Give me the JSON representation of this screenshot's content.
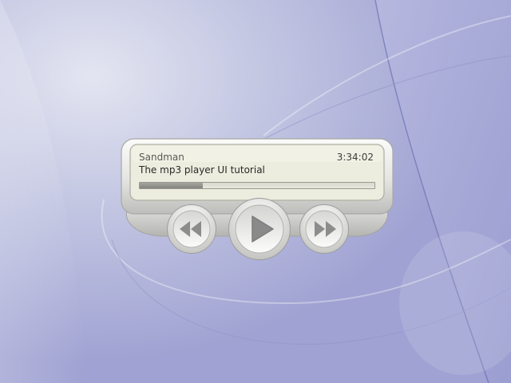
{
  "player": {
    "artist": "Sandman",
    "track_title": "The mp3 player UI tutorial",
    "time": "3:34:02",
    "progress_fraction": 0.27,
    "buttons": {
      "rewind": "rewind-icon",
      "play": "play-icon",
      "forward": "fast-forward-icon"
    }
  },
  "colors": {
    "wallpaper_base": "#a9abd6",
    "wallpaper_light": "#d9dcec",
    "shell_light": "#f2f2f0",
    "shell_dark": "#b9b9b6",
    "lcd_background": "#e6e6d8",
    "icon_gray": "#8c8c8c"
  }
}
